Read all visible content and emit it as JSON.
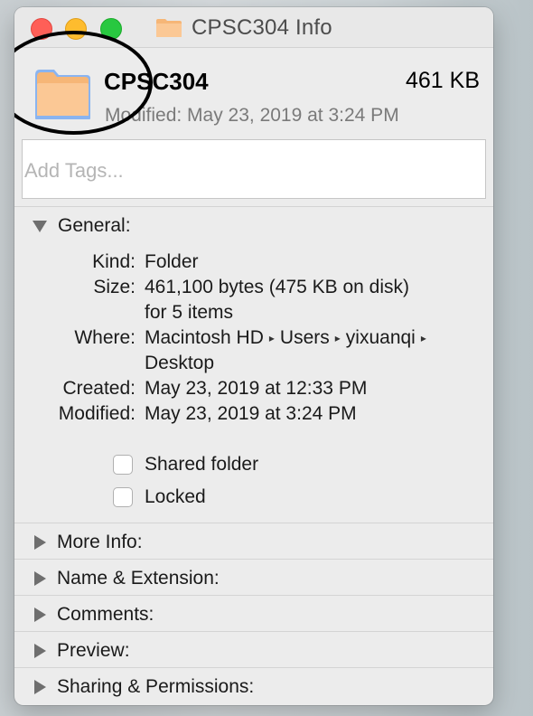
{
  "window": {
    "title": "CPSC304 Info"
  },
  "header": {
    "name": "CPSC304",
    "size": "461 KB",
    "modified": "Modified: May 23, 2019 at 3:24 PM",
    "icon": "folder-icon"
  },
  "tags": {
    "placeholder": "Add Tags..."
  },
  "general": {
    "label": "General:",
    "kind_key": "Kind:",
    "kind_val": "Folder",
    "size_key": "Size:",
    "size_val": "461,100 bytes (475 KB on disk)",
    "size_val2": "for 5 items",
    "where_key": "Where:",
    "where_parts": [
      "Macintosh HD",
      "Users",
      "yixuanqi"
    ],
    "where_sep": "▸",
    "where_val2": "Desktop",
    "created_key": "Created:",
    "created_val": "May 23, 2019 at 12:33 PM",
    "modified_key": "Modified:",
    "modified_val": "May 23, 2019 at 3:24 PM",
    "shared_label": "Shared folder",
    "locked_label": "Locked"
  },
  "sections": [
    {
      "label": "More Info:"
    },
    {
      "label": "Name & Extension:"
    },
    {
      "label": "Comments:"
    },
    {
      "label": "Preview:"
    },
    {
      "label": "Sharing & Permissions:"
    }
  ],
  "colors": {
    "folder": "#fbc895",
    "folder_tab": "#f6b677",
    "folder_edge": "#8ab4f0"
  }
}
